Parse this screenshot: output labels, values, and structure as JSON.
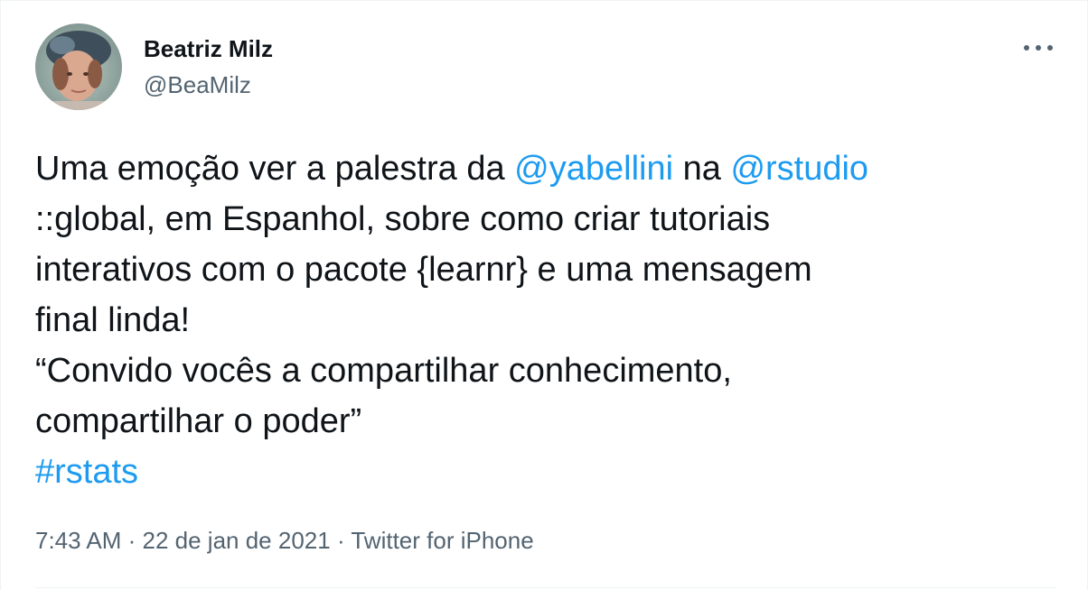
{
  "author": {
    "display_name": "Beatriz Milz",
    "handle": "@BeaMilz"
  },
  "tweet": {
    "line1": {
      "pre": "Uma emoção ver a palestra da ",
      "mention1": "@yabellini",
      "mid": " na ",
      "mention2": "@rstudio"
    },
    "line2": "::global, em Espanhol, sobre como criar tutoriais",
    "line3": "interativos com o pacote {learnr} e uma mensagem",
    "line4": "final linda!",
    "line5": "“Convido vocês a compartilhar conhecimento,",
    "line6": "compartilhar o poder”",
    "hashtag": "#rstats"
  },
  "meta": {
    "time": "7:43 AM",
    "sep1": " · ",
    "date": "22 de jan de 2021",
    "sep2": " · ",
    "source": "Twitter for iPhone"
  },
  "icons": {
    "more": "more-horizontal-icon"
  },
  "colors": {
    "link": "#1d9bf0",
    "text": "#0f1419",
    "secondary": "#536471"
  }
}
